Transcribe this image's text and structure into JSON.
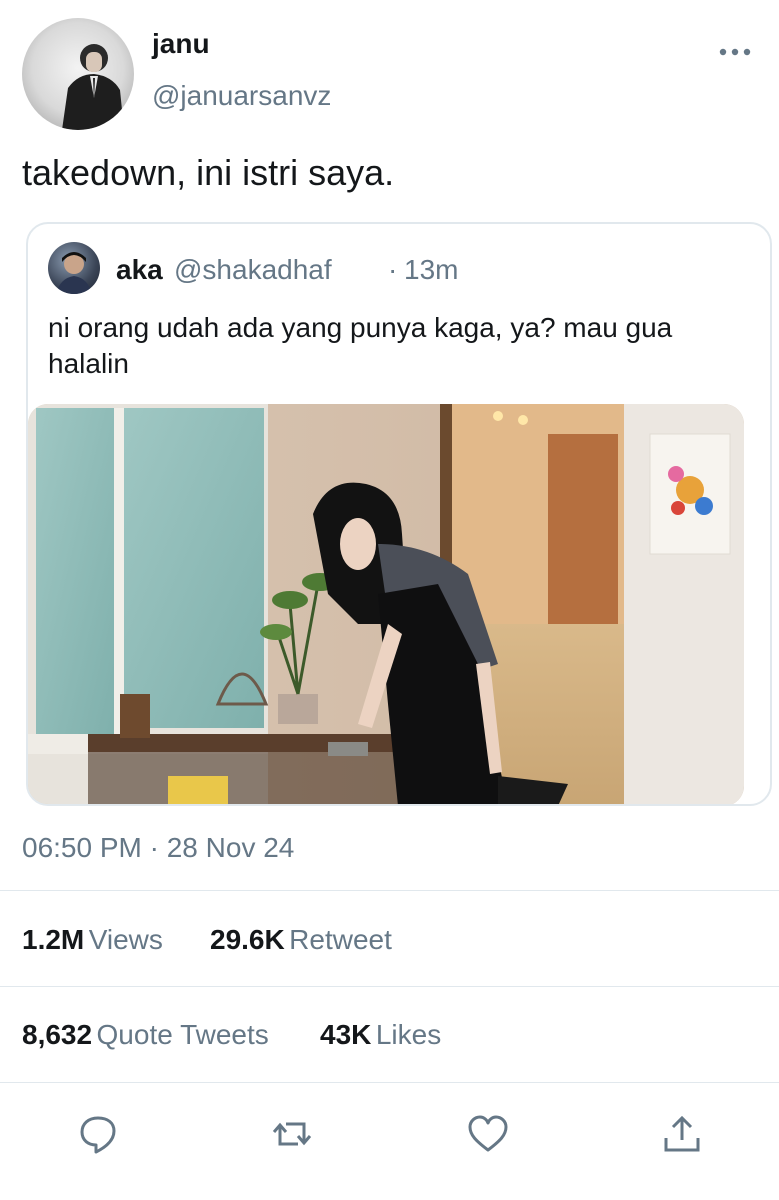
{
  "author": {
    "display_name": "janu",
    "handle": "@januarsanvz",
    "avatar_icon": "person-in-suit-avatar"
  },
  "tweet": {
    "text": "takedown, ini istri saya.",
    "timestamp": "06:50 PM · 28 Nov 24"
  },
  "quote": {
    "display_name": "aka",
    "handle": "@shakadhaf",
    "separator": "·",
    "time": "13m",
    "text": "ni orang udah ada yang punya kaga, ya? mau gua halalin",
    "media": "photo"
  },
  "stats": {
    "views_count": "1.2M",
    "views_label": "Views",
    "retweet_count": "29.6K",
    "retweet_label": "Retweet",
    "quote_count": "8,632",
    "quote_label": "Quote Tweets",
    "likes_count": "43K",
    "likes_label": "Likes"
  },
  "actions": [
    "reply-icon",
    "retweet-icon",
    "like-icon",
    "share-icon"
  ],
  "colors": {
    "text_primary": "#14171a",
    "text_secondary": "#657786",
    "divider": "#e1e8ed",
    "action_icon": "#657786"
  }
}
